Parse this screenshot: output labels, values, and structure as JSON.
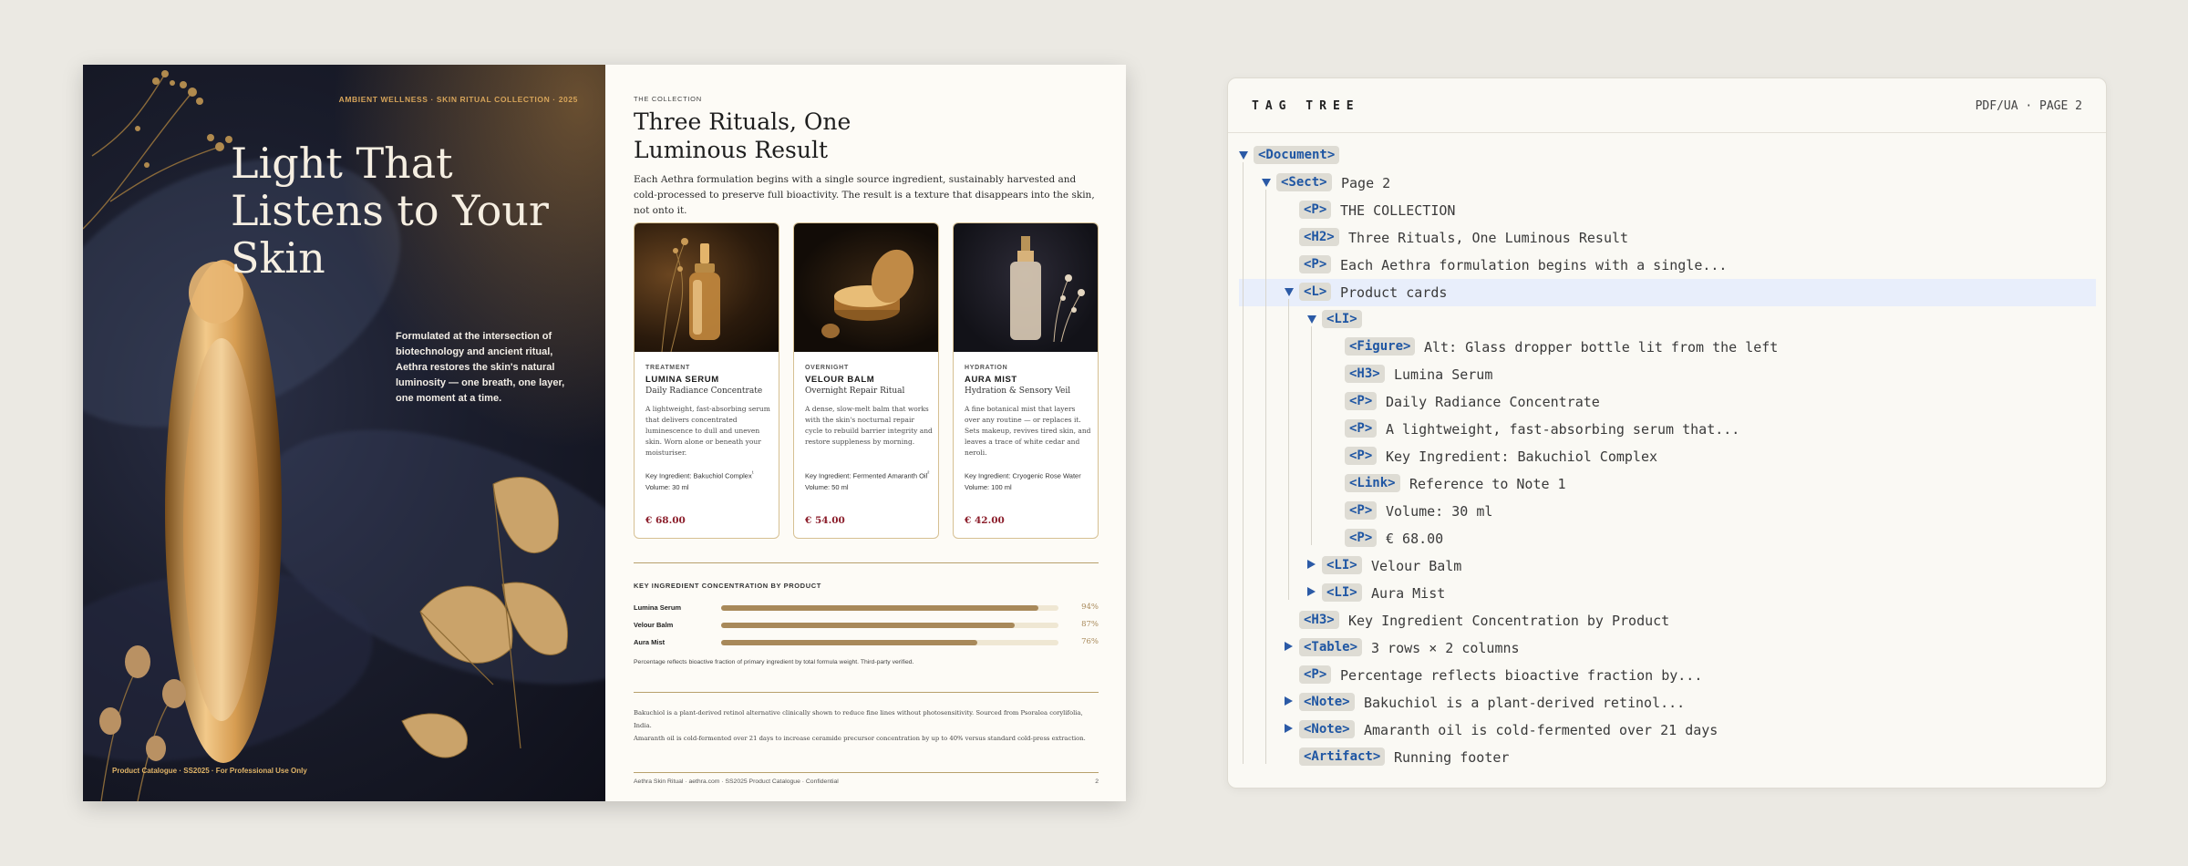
{
  "left_page": {
    "kicker": "AMBIENT WELLNESS · SKIN RITUAL COLLECTION · 2025",
    "hero_title": "Light That Listens to Your Skin",
    "hero_copy": "Formulated at the intersection of biotechnology and ancient ritual, Aethra restores the skin's natural luminosity — one breath, one layer, one moment at a time.",
    "footer": "Product Catalogue · SS2025 · For Professional Use Only"
  },
  "right_page": {
    "eyebrow": "THE COLLECTION",
    "title": "Three Rituals, One Luminous Result",
    "lede": "Each Aethra formulation begins with a single source ingredient, sustainably harvested and cold-processed to preserve full bioactivity. The result is a texture that disappears into the skin, not onto it.",
    "products": [
      {
        "category": "TREATMENT",
        "name": "LUMINA SERUM",
        "subtitle": "Daily Radiance Concentrate",
        "description": "A lightweight, fast-absorbing serum that delivers concentrated luminescence to dull and uneven skin. Worn alone or beneath your moisturiser.",
        "ingredient": "Key Ingredient: Bakuchiol Complex",
        "ingredient_mark": "¹",
        "volume": "Volume: 30 ml",
        "price": "€ 68.00"
      },
      {
        "category": "OVERNIGHT",
        "name": "VELOUR BALM",
        "subtitle": "Overnight Repair Ritual",
        "description": "A dense, slow-melt balm that works with the skin's nocturnal repair cycle to rebuild barrier integrity and restore suppleness by morning.",
        "ingredient": "Key Ingredient: Fermented Amaranth Oil",
        "ingredient_mark": "²",
        "volume": "Volume: 50 ml",
        "price": "€ 54.00"
      },
      {
        "category": "HYDRATION",
        "name": "AURA MIST",
        "subtitle": "Hydration & Sensory Veil",
        "description": "A fine botanical mist that layers over any routine — or replaces it. Sets makeup, revives tired skin, and leaves a trace of white cedar and neroli.",
        "ingredient": "Key Ingredient: Cryogenic Rose Water",
        "ingredient_mark": "",
        "volume": "Volume: 100 ml",
        "price": "€ 42.00"
      }
    ],
    "concentration": {
      "title": "KEY INGREDIENT CONCENTRATION BY PRODUCT",
      "rows": [
        {
          "label": "Lumina Serum",
          "value": 94,
          "display": "94%"
        },
        {
          "label": "Velour Balm",
          "value": 87,
          "display": "87%"
        },
        {
          "label": "Aura Mist",
          "value": 76,
          "display": "76%"
        }
      ],
      "note": "Percentage reflects bioactive fraction of primary ingredient by total formula weight. Third-party verified."
    },
    "notes": [
      "Bakuchiol is a plant-derived retinol alternative clinically shown to reduce fine lines without photosensitivity. Sourced from Psoralea corylifolia, India.",
      "Amaranth oil is cold-fermented over 21 days to increase ceramide precursor concentration by up to 40% versus standard cold-press extraction."
    ],
    "footer": "Aethra Skin Ritual · aethra.com · SS2025 Product Catalogue · Confidential",
    "page_number": "2"
  },
  "panel": {
    "title": "TAG TREE",
    "meta": "PDF/UA · PAGE 2",
    "accent": "#1f56a3",
    "rows": [
      {
        "depth": 0,
        "toggle": "open",
        "tag": "<Document>",
        "text": ""
      },
      {
        "depth": 1,
        "toggle": "open",
        "tag": "<Sect>",
        "text": "Page 2"
      },
      {
        "depth": 2,
        "toggle": "",
        "tag": "<P>",
        "text": "THE COLLECTION"
      },
      {
        "depth": 2,
        "toggle": "",
        "tag": "<H2>",
        "text": "Three Rituals, One Luminous Result"
      },
      {
        "depth": 2,
        "toggle": "",
        "tag": "<P>",
        "text": "Each Aethra formulation begins with a single..."
      },
      {
        "depth": 2,
        "toggle": "open",
        "tag": "<L>",
        "text": "Product cards",
        "selected": true
      },
      {
        "depth": 3,
        "toggle": "open",
        "tag": "<LI>",
        "text": ""
      },
      {
        "depth": 4,
        "toggle": "",
        "tag": "<Figure>",
        "text": "Alt: Glass dropper bottle lit from the left"
      },
      {
        "depth": 4,
        "toggle": "",
        "tag": "<H3>",
        "text": "Lumina Serum"
      },
      {
        "depth": 4,
        "toggle": "",
        "tag": "<P>",
        "text": "Daily Radiance Concentrate"
      },
      {
        "depth": 4,
        "toggle": "",
        "tag": "<P>",
        "text": "A lightweight, fast-absorbing serum that..."
      },
      {
        "depth": 4,
        "toggle": "",
        "tag": "<P>",
        "text": "Key Ingredient: Bakuchiol Complex"
      },
      {
        "depth": 4,
        "toggle": "",
        "tag": "<Link>",
        "text": "Reference to Note 1"
      },
      {
        "depth": 4,
        "toggle": "",
        "tag": "<P>",
        "text": "Volume: 30 ml"
      },
      {
        "depth": 4,
        "toggle": "",
        "tag": "<P>",
        "text": "€ 68.00"
      },
      {
        "depth": 3,
        "toggle": "closed",
        "tag": "<LI>",
        "text": "Velour Balm"
      },
      {
        "depth": 3,
        "toggle": "closed",
        "tag": "<LI>",
        "text": "Aura Mist"
      },
      {
        "depth": 2,
        "toggle": "",
        "tag": "<H3>",
        "text": "Key Ingredient Concentration by Product"
      },
      {
        "depth": 2,
        "toggle": "closed",
        "tag": "<Table>",
        "text": "3 rows × 2 columns"
      },
      {
        "depth": 2,
        "toggle": "",
        "tag": "<P>",
        "text": "Percentage reflects bioactive fraction by..."
      },
      {
        "depth": 2,
        "toggle": "closed",
        "tag": "<Note>",
        "text": "Bakuchiol is a plant-derived retinol..."
      },
      {
        "depth": 2,
        "toggle": "closed",
        "tag": "<Note>",
        "text": "Amaranth oil is cold-fermented over 21 days"
      },
      {
        "depth": 2,
        "toggle": "",
        "tag": "<Artifact>",
        "text": "Running footer"
      }
    ]
  }
}
